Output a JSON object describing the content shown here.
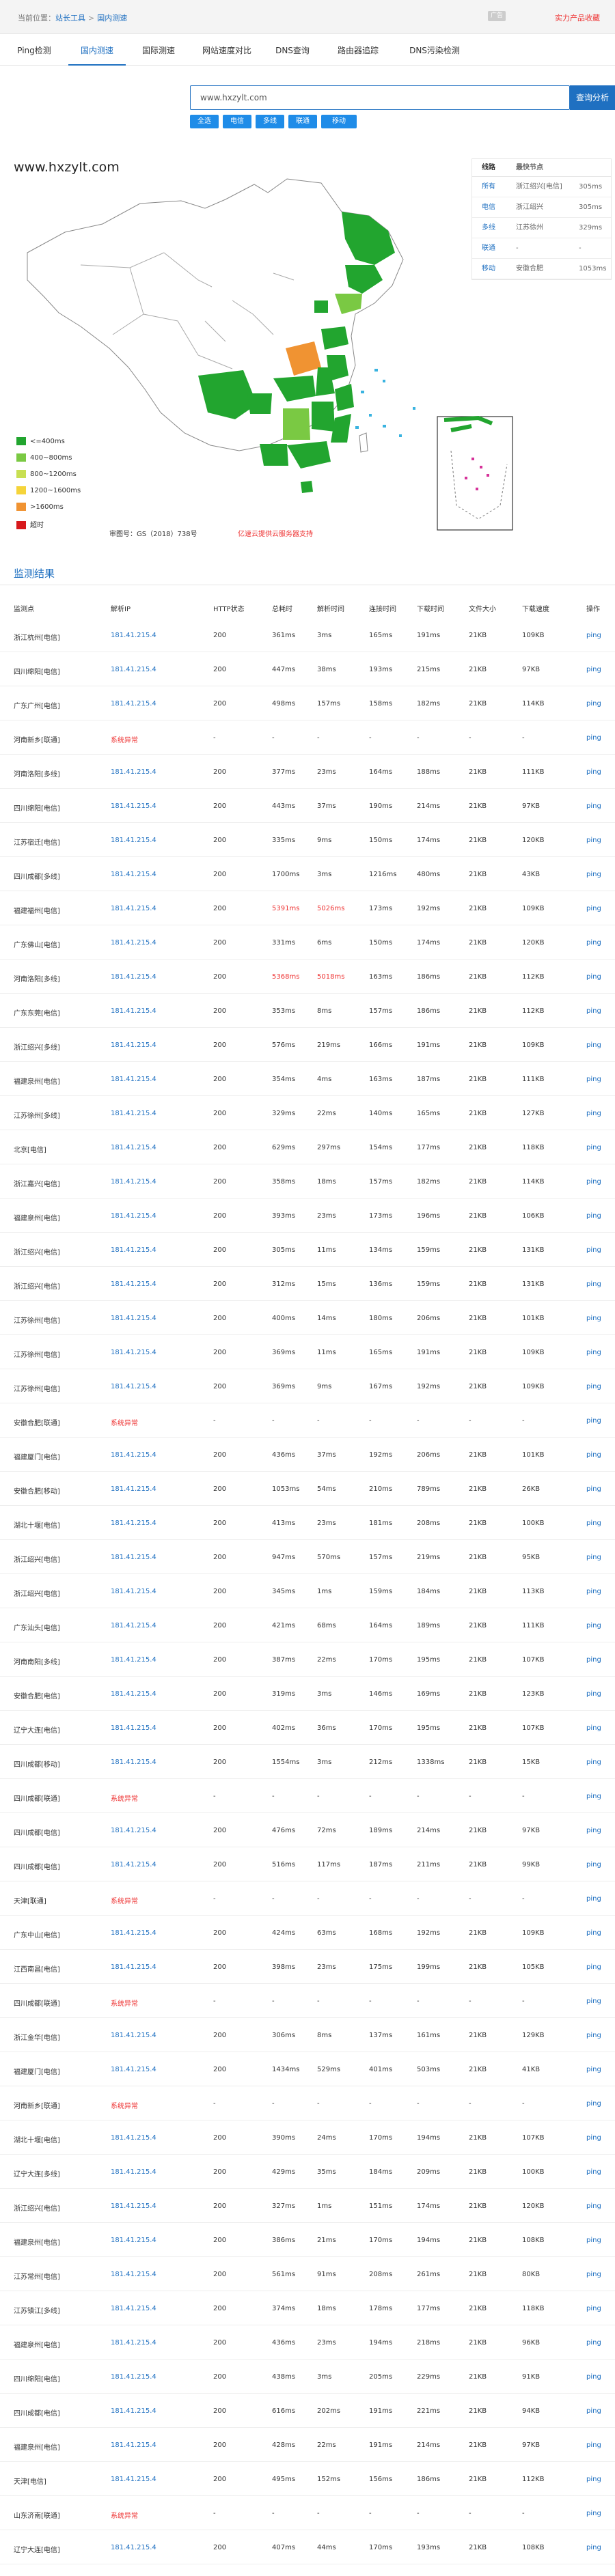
{
  "breadcrumb": {
    "prefix": "当前位置：",
    "home": "站长工具",
    "sep": ">",
    "current": "国内测速"
  },
  "badge": "广告",
  "promo": "实力产品收藏",
  "tabs": [
    "Ping检测",
    "国内测速",
    "国际测速",
    "网站速度对比",
    "DNS查询",
    "路由器追踪",
    "DNS污染检测"
  ],
  "search": {
    "value": "www.hxzylt.com",
    "button": "查询分析"
  },
  "filters": [
    "全选",
    "电信",
    "多线",
    "联通",
    "移动"
  ],
  "map": {
    "site": "www.hxzylt.com",
    "legend": [
      {
        "label": "<=400ms",
        "color": "#22a52f"
      },
      {
        "label": "400~800ms",
        "color": "#7ac943"
      },
      {
        "label": "800~1200ms",
        "color": "#c8df52"
      },
      {
        "label": "1200~1600ms",
        "color": "#f5d43a"
      },
      {
        "label": ">1600ms",
        "color": "#f09332"
      },
      {
        "label": "超时",
        "color": "#d7191c"
      }
    ],
    "approval": "审图号：GS（2018）738号",
    "support": "亿速云提供云服务器支持"
  },
  "line_table": {
    "headers": [
      "线路",
      "最快节点"
    ],
    "rows": [
      [
        "所有",
        "浙江绍兴[电信]",
        "305ms"
      ],
      [
        "电信",
        "浙江绍兴",
        "305ms"
      ],
      [
        "多线",
        "江苏徐州",
        "329ms"
      ],
      [
        "联通",
        "-",
        "-"
      ],
      [
        "移动",
        "安徽合肥",
        "1053ms"
      ]
    ]
  },
  "results": {
    "title": "监测结果",
    "headers": [
      "监测点",
      "解析IP",
      "HTTP状态",
      "总耗时",
      "解析时间",
      "连接时间",
      "下载时间",
      "文件大小",
      "下载速度",
      "操作"
    ],
    "rows": [
      [
        "浙江杭州[电信]",
        "181.41.215.4",
        "200",
        "361ms",
        "3ms",
        "165ms",
        "191ms",
        "21KB",
        "109KB",
        "ping"
      ],
      [
        "四川绵阳[电信]",
        "181.41.215.4",
        "200",
        "447ms",
        "38ms",
        "193ms",
        "215ms",
        "21KB",
        "97KB",
        "ping"
      ],
      [
        "广东广州[电信]",
        "181.41.215.4",
        "200",
        "498ms",
        "157ms",
        "158ms",
        "182ms",
        "21KB",
        "114KB",
        "ping"
      ],
      [
        "河南新乡[联通]",
        "系统异常",
        "-",
        "-",
        "-",
        "-",
        "-",
        "-",
        "-",
        "ping"
      ],
      [
        "河南洛阳[多线]",
        "181.41.215.4",
        "200",
        "377ms",
        "23ms",
        "164ms",
        "188ms",
        "21KB",
        "111KB",
        "ping"
      ],
      [
        "四川绵阳[电信]",
        "181.41.215.4",
        "200",
        "443ms",
        "37ms",
        "190ms",
        "214ms",
        "21KB",
        "97KB",
        "ping"
      ],
      [
        "江苏宿迁[电信]",
        "181.41.215.4",
        "200",
        "335ms",
        "9ms",
        "150ms",
        "174ms",
        "21KB",
        "120KB",
        "ping"
      ],
      [
        "四川成都[多线]",
        "181.41.215.4",
        "200",
        "1700ms",
        "3ms",
        "1216ms",
        "480ms",
        "21KB",
        "43KB",
        "ping"
      ],
      [
        "福建福州[电信]",
        "181.41.215.4",
        "200",
        "5391ms",
        "5026ms",
        "173ms",
        "192ms",
        "21KB",
        "109KB",
        "ping"
      ],
      [
        "广东佛山[电信]",
        "181.41.215.4",
        "200",
        "331ms",
        "6ms",
        "150ms",
        "174ms",
        "21KB",
        "120KB",
        "ping"
      ],
      [
        "河南洛阳[多线]",
        "181.41.215.4",
        "200",
        "5368ms",
        "5018ms",
        "163ms",
        "186ms",
        "21KB",
        "112KB",
        "ping"
      ],
      [
        "广东东莞[电信]",
        "181.41.215.4",
        "200",
        "353ms",
        "8ms",
        "157ms",
        "186ms",
        "21KB",
        "112KB",
        "ping"
      ],
      [
        "浙江绍兴[多线]",
        "181.41.215.4",
        "200",
        "576ms",
        "219ms",
        "166ms",
        "191ms",
        "21KB",
        "109KB",
        "ping"
      ],
      [
        "福建泉州[电信]",
        "181.41.215.4",
        "200",
        "354ms",
        "4ms",
        "163ms",
        "187ms",
        "21KB",
        "111KB",
        "ping"
      ],
      [
        "江苏徐州[多线]",
        "181.41.215.4",
        "200",
        "329ms",
        "22ms",
        "140ms",
        "165ms",
        "21KB",
        "127KB",
        "ping"
      ],
      [
        "北京[电信]",
        "181.41.215.4",
        "200",
        "629ms",
        "297ms",
        "154ms",
        "177ms",
        "21KB",
        "118KB",
        "ping"
      ],
      [
        "浙江嘉兴[电信]",
        "181.41.215.4",
        "200",
        "358ms",
        "18ms",
        "157ms",
        "182ms",
        "21KB",
        "114KB",
        "ping"
      ],
      [
        "福建泉州[电信]",
        "181.41.215.4",
        "200",
        "393ms",
        "23ms",
        "173ms",
        "196ms",
        "21KB",
        "106KB",
        "ping"
      ],
      [
        "浙江绍兴[电信]",
        "181.41.215.4",
        "200",
        "305ms",
        "11ms",
        "134ms",
        "159ms",
        "21KB",
        "131KB",
        "ping"
      ],
      [
        "浙江绍兴[电信]",
        "181.41.215.4",
        "200",
        "312ms",
        "15ms",
        "136ms",
        "159ms",
        "21KB",
        "131KB",
        "ping"
      ],
      [
        "江苏徐州[电信]",
        "181.41.215.4",
        "200",
        "400ms",
        "14ms",
        "180ms",
        "206ms",
        "21KB",
        "101KB",
        "ping"
      ],
      [
        "江苏徐州[电信]",
        "181.41.215.4",
        "200",
        "369ms",
        "11ms",
        "165ms",
        "191ms",
        "21KB",
        "109KB",
        "ping"
      ],
      [
        "江苏徐州[电信]",
        "181.41.215.4",
        "200",
        "369ms",
        "9ms",
        "167ms",
        "192ms",
        "21KB",
        "109KB",
        "ping"
      ],
      [
        "安徽合肥[联通]",
        "系统异常",
        "-",
        "-",
        "-",
        "-",
        "-",
        "-",
        "-",
        "ping"
      ],
      [
        "福建厦门[电信]",
        "181.41.215.4",
        "200",
        "436ms",
        "37ms",
        "192ms",
        "206ms",
        "21KB",
        "101KB",
        "ping"
      ],
      [
        "安徽合肥[移动]",
        "181.41.215.4",
        "200",
        "1053ms",
        "54ms",
        "210ms",
        "789ms",
        "21KB",
        "26KB",
        "ping"
      ],
      [
        "湖北十堰[电信]",
        "181.41.215.4",
        "200",
        "413ms",
        "23ms",
        "181ms",
        "208ms",
        "21KB",
        "100KB",
        "ping"
      ],
      [
        "浙江绍兴[电信]",
        "181.41.215.4",
        "200",
        "947ms",
        "570ms",
        "157ms",
        "219ms",
        "21KB",
        "95KB",
        "ping"
      ],
      [
        "浙江绍兴[电信]",
        "181.41.215.4",
        "200",
        "345ms",
        "1ms",
        "159ms",
        "184ms",
        "21KB",
        "113KB",
        "ping"
      ],
      [
        "广东汕头[电信]",
        "181.41.215.4",
        "200",
        "421ms",
        "68ms",
        "164ms",
        "189ms",
        "21KB",
        "111KB",
        "ping"
      ],
      [
        "河南南阳[多线]",
        "181.41.215.4",
        "200",
        "387ms",
        "22ms",
        "170ms",
        "195ms",
        "21KB",
        "107KB",
        "ping"
      ],
      [
        "安徽合肥[电信]",
        "181.41.215.4",
        "200",
        "319ms",
        "3ms",
        "146ms",
        "169ms",
        "21KB",
        "123KB",
        "ping"
      ],
      [
        "辽宁大连[电信]",
        "181.41.215.4",
        "200",
        "402ms",
        "36ms",
        "170ms",
        "195ms",
        "21KB",
        "107KB",
        "ping"
      ],
      [
        "四川成都[移动]",
        "181.41.215.4",
        "200",
        "1554ms",
        "3ms",
        "212ms",
        "1338ms",
        "21KB",
        "15KB",
        "ping"
      ],
      [
        "四川成都[联通]",
        "系统异常",
        "-",
        "-",
        "-",
        "-",
        "-",
        "-",
        "-",
        "ping"
      ],
      [
        "四川成都[电信]",
        "181.41.215.4",
        "200",
        "476ms",
        "72ms",
        "189ms",
        "214ms",
        "21KB",
        "97KB",
        "ping"
      ],
      [
        "四川成都[电信]",
        "181.41.215.4",
        "200",
        "516ms",
        "117ms",
        "187ms",
        "211ms",
        "21KB",
        "99KB",
        "ping"
      ],
      [
        "天津[联通]",
        "系统异常",
        "-",
        "-",
        "-",
        "-",
        "-",
        "-",
        "-",
        "ping"
      ],
      [
        "广东中山[电信]",
        "181.41.215.4",
        "200",
        "424ms",
        "63ms",
        "168ms",
        "192ms",
        "21KB",
        "109KB",
        "ping"
      ],
      [
        "江西南昌[电信]",
        "181.41.215.4",
        "200",
        "398ms",
        "23ms",
        "175ms",
        "199ms",
        "21KB",
        "105KB",
        "ping"
      ],
      [
        "四川成都[联通]",
        "系统异常",
        "-",
        "-",
        "-",
        "-",
        "-",
        "-",
        "-",
        "ping"
      ],
      [
        "浙江金华[电信]",
        "181.41.215.4",
        "200",
        "306ms",
        "8ms",
        "137ms",
        "161ms",
        "21KB",
        "129KB",
        "ping"
      ],
      [
        "福建厦门[电信]",
        "181.41.215.4",
        "200",
        "1434ms",
        "529ms",
        "401ms",
        "503ms",
        "21KB",
        "41KB",
        "ping"
      ],
      [
        "河南新乡[联通]",
        "系统异常",
        "-",
        "-",
        "-",
        "-",
        "-",
        "-",
        "-",
        "ping"
      ],
      [
        "湖北十堰[电信]",
        "181.41.215.4",
        "200",
        "390ms",
        "24ms",
        "170ms",
        "194ms",
        "21KB",
        "107KB",
        "ping"
      ],
      [
        "辽宁大连[多线]",
        "181.41.215.4",
        "200",
        "429ms",
        "35ms",
        "184ms",
        "209ms",
        "21KB",
        "100KB",
        "ping"
      ],
      [
        "浙江绍兴[电信]",
        "181.41.215.4",
        "200",
        "327ms",
        "1ms",
        "151ms",
        "174ms",
        "21KB",
        "120KB",
        "ping"
      ],
      [
        "福建泉州[电信]",
        "181.41.215.4",
        "200",
        "386ms",
        "21ms",
        "170ms",
        "194ms",
        "21KB",
        "108KB",
        "ping"
      ],
      [
        "江苏常州[电信]",
        "181.41.215.4",
        "200",
        "561ms",
        "91ms",
        "208ms",
        "261ms",
        "21KB",
        "80KB",
        "ping"
      ],
      [
        "江苏镇江[多线]",
        "181.41.215.4",
        "200",
        "374ms",
        "18ms",
        "178ms",
        "177ms",
        "21KB",
        "118KB",
        "ping"
      ],
      [
        "福建泉州[电信]",
        "181.41.215.4",
        "200",
        "436ms",
        "23ms",
        "194ms",
        "218ms",
        "21KB",
        "96KB",
        "ping"
      ],
      [
        "四川绵阳[电信]",
        "181.41.215.4",
        "200",
        "438ms",
        "3ms",
        "205ms",
        "229ms",
        "21KB",
        "91KB",
        "ping"
      ],
      [
        "四川成都[电信]",
        "181.41.215.4",
        "200",
        "616ms",
        "202ms",
        "191ms",
        "221ms",
        "21KB",
        "94KB",
        "ping"
      ],
      [
        "福建泉州[电信]",
        "181.41.215.4",
        "200",
        "428ms",
        "22ms",
        "191ms",
        "214ms",
        "21KB",
        "97KB",
        "ping"
      ],
      [
        "天津[电信]",
        "181.41.215.4",
        "200",
        "495ms",
        "152ms",
        "156ms",
        "186ms",
        "21KB",
        "112KB",
        "ping"
      ],
      [
        "山东济南[联通]",
        "系统异常",
        "-",
        "-",
        "-",
        "-",
        "-",
        "-",
        "-",
        "ping"
      ],
      [
        "辽宁大连[电信]",
        "181.41.215.4",
        "200",
        "407ms",
        "44ms",
        "170ms",
        "193ms",
        "21KB",
        "108KB",
        "ping"
      ]
    ]
  }
}
